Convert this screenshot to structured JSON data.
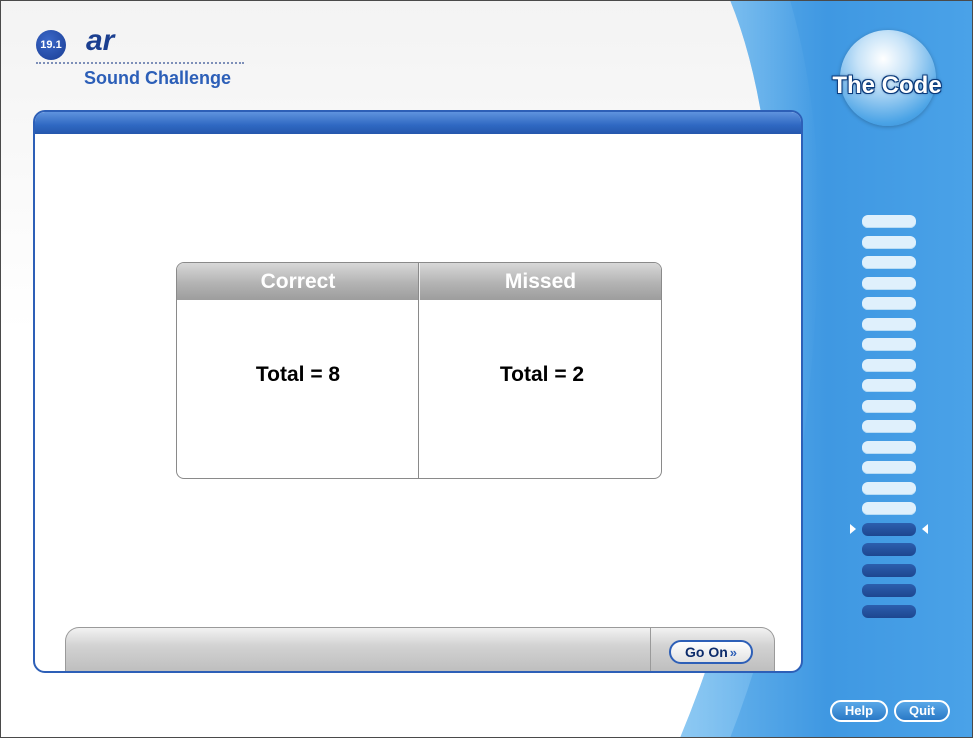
{
  "header": {
    "lesson_number": "19.1",
    "lesson_title": "ar",
    "activity_title": "Sound Challenge",
    "brand_title": "The Code"
  },
  "results": {
    "columns": [
      {
        "heading": "Correct",
        "total_label": "Total = 8"
      },
      {
        "heading": "Missed",
        "total_label": "Total = 2"
      }
    ],
    "correct_count": 8,
    "missed_count": 2
  },
  "navigation": {
    "go_on_label": "Go On",
    "go_on_icon": "double-chevron-right-icon",
    "help_label": "Help",
    "quit_label": "Quit"
  },
  "progress": {
    "total_segments": 20,
    "completed_segments": 15,
    "current_segment": 16,
    "completed_color": "#dff0fc",
    "remaining_color": "#1d468f"
  },
  "colors": {
    "accent_blue": "#2d5fb7",
    "band_blue": "#3f98e2",
    "header_text": "#1b3f90"
  }
}
